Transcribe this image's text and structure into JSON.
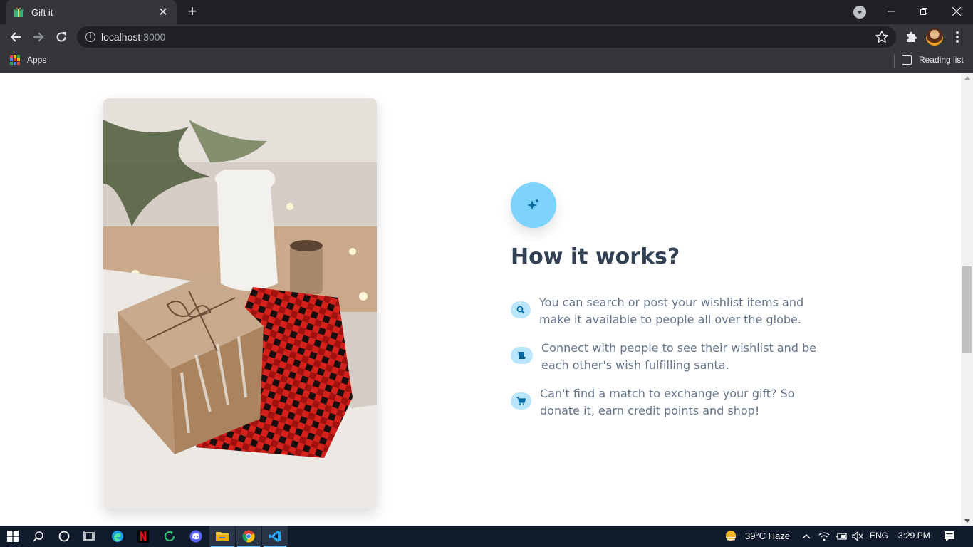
{
  "browser": {
    "tab_title": "Gift it",
    "url_host": "localhost",
    "url_port": ":3000",
    "bookmarks": {
      "apps_label": "Apps",
      "reading_list_label": "Reading list"
    }
  },
  "page": {
    "heading": "How it works?",
    "badge_icon": "sparkles-icon",
    "steps": [
      {
        "icon": "search-icon",
        "text": "You can search or post your wishlist items and make it available to people all over the globe."
      },
      {
        "icon": "scroll-icon",
        "text": "Connect with people to see their wishlist and be each other's wish fulfilling santa."
      },
      {
        "icon": "shopping-cart-icon",
        "text": "Can't find a match to exchange your gift? So donate it, earn credit points and shop!"
      }
    ],
    "accent_color": "#7dd3fc",
    "heading_color": "#334155",
    "text_color": "#64748b"
  },
  "taskbar": {
    "weather": "39°C  Haze",
    "language": "ENG",
    "time": "3:29 PM"
  }
}
